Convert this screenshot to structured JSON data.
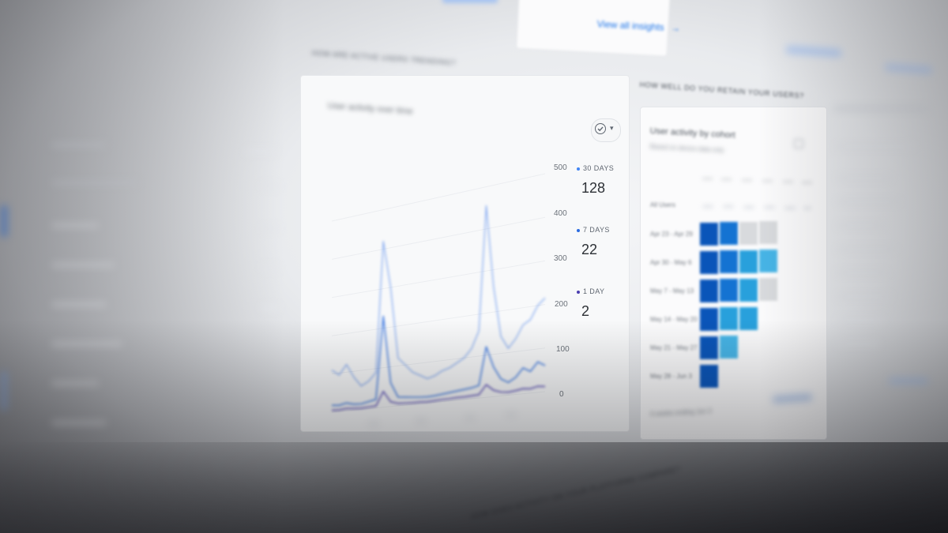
{
  "insights": {
    "view_all_label": "View all insights",
    "arrow": "→"
  },
  "activity_section": {
    "header_text": "HOW ARE ACTIVE USERS TRENDING?",
    "card_title": "User activity over time",
    "check_icon": "check-circle-icon",
    "dropdown_arrow": "▾"
  },
  "chart_data": {
    "type": "line",
    "title": "",
    "xlabel": "",
    "ylabel": "",
    "ylim": [
      0,
      500
    ],
    "yticks": [
      "500",
      "400",
      "300",
      "200",
      "100",
      "0"
    ],
    "x": [
      0,
      1,
      2,
      3,
      4,
      5,
      6,
      7,
      8,
      9,
      10,
      11,
      12,
      13,
      14,
      15,
      16,
      17,
      18,
      19,
      20,
      21,
      22,
      23,
      24,
      25,
      26,
      27,
      28,
      29
    ],
    "series": [
      {
        "name": "30 DAYS",
        "color": "#5b8dee",
        "values": [
          110,
          95,
          120,
          85,
          60,
          70,
          90,
          420,
          300,
          120,
          100,
          80,
          70,
          60,
          65,
          75,
          80,
          90,
          100,
          120,
          160,
          455,
          260,
          140,
          110,
          130,
          160,
          170,
          200,
          215
        ]
      },
      {
        "name": "7 DAYS",
        "color": "#2f6fe0",
        "values": [
          18,
          16,
          20,
          15,
          14,
          18,
          22,
          230,
          60,
          22,
          20,
          18,
          16,
          15,
          16,
          18,
          20,
          22,
          24,
          26,
          30,
          120,
          70,
          40,
          30,
          40,
          60,
          50,
          70,
          60
        ]
      },
      {
        "name": "1 DAY",
        "color": "#4b3fb0",
        "values": [
          5,
          4,
          6,
          4,
          3,
          4,
          5,
          40,
          12,
          6,
          5,
          4,
          4,
          3,
          4,
          5,
          5,
          6,
          6,
          7,
          8,
          30,
          15,
          9,
          7,
          9,
          12,
          10,
          14,
          12
        ]
      }
    ]
  },
  "metrics": [
    {
      "label": "30 DAYS",
      "value": "128",
      "color": "#4285f4"
    },
    {
      "label": "7 DAYS",
      "value": "22",
      "color": "#2b6be0"
    },
    {
      "label": "1 DAY",
      "value": "2",
      "color": "#4b3fb0"
    }
  ],
  "retention": {
    "header_text": "HOW WELL DO YOU RETAIN YOUR USERS?",
    "card_title": "User activity by cohort",
    "card_subtitle": "Based on device data only",
    "all_users_label": "All Users",
    "rows": [
      {
        "label": "Apr 23 - Apr 29",
        "levels": [
          1.0,
          0.85,
          0.15,
          0.12
        ]
      },
      {
        "label": "Apr 30 - May 6",
        "levels": [
          1.0,
          0.85,
          0.6,
          0.5
        ]
      },
      {
        "label": "May 7 - May 13",
        "levels": [
          1.0,
          0.85,
          0.7,
          0.1
        ]
      },
      {
        "label": "May 14 - May 20",
        "levels": [
          1.0,
          0.7,
          0.6
        ]
      },
      {
        "label": "May 21 - May 27",
        "levels": [
          1.0,
          0.35
        ]
      },
      {
        "label": "May 28 - Jun 3",
        "levels": [
          1.0
        ]
      }
    ],
    "footer_text": "6 weeks ending Jun 3"
  },
  "platforms": {
    "header_text": "HOW DOES ACTIVITY ON YOUR PLATFORMS COMPARE?"
  }
}
